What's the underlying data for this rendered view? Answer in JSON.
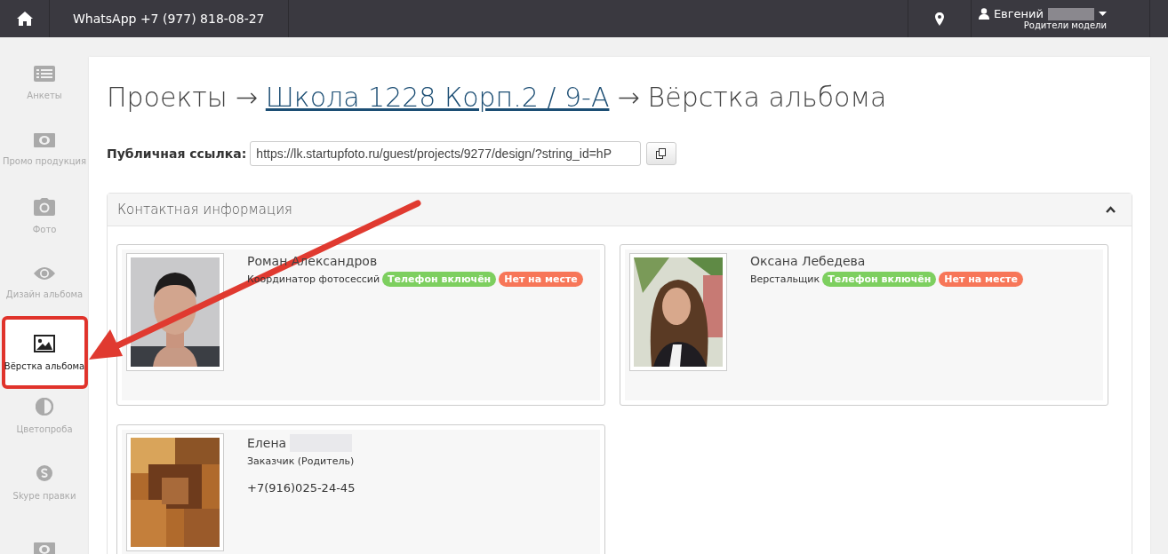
{
  "topbar": {
    "whatsapp": "WhatsApp +7 (977) 818-08-27",
    "user": {
      "name": "Евгений",
      "redacted": true,
      "role": "Родители модели"
    }
  },
  "sidebar": {
    "items": [
      {
        "label": "Анкеты",
        "selected": false
      },
      {
        "label": "Промо продукция",
        "selected": false
      },
      {
        "label": "Фото",
        "selected": false
      },
      {
        "label": "Дизайн альбома",
        "selected": false
      },
      {
        "label": "Вёрстка альбома",
        "selected": true
      },
      {
        "label": "Цветопроба",
        "selected": false
      },
      {
        "label": "Skype правки",
        "selected": false
      },
      {
        "selected": false
      }
    ]
  },
  "breadcrumb": {
    "root": "Проекты",
    "separator": "→",
    "link": "Школа 1228 Корп.2 / 9-А",
    "current": "Вёрстка альбома"
  },
  "public_link": {
    "label": "Публичная ссылка:",
    "value": "https://lk.startupfoto.ru/guest/projects/9277/design/?string_id=hP"
  },
  "contacts_panel": {
    "title": "Контактная информация",
    "expanded": true,
    "contacts": [
      {
        "name": "Роман Александров",
        "redacted": false,
        "role": "Координатор фотосессий",
        "badges": [
          {
            "label": "Телефон включён",
            "color": "#7dcf5f"
          },
          {
            "label": "Нет на месте",
            "color": "#f77658"
          }
        ]
      },
      {
        "name": "Оксана Лебедева",
        "redacted": false,
        "role": "Верстальщик",
        "badges": [
          {
            "label": "Телефон включён",
            "color": "#7dcf5f"
          },
          {
            "label": "Нет на месте",
            "color": "#f77658"
          }
        ]
      },
      {
        "name": "Елена",
        "redacted": true,
        "role": "Заказчик (Родитель)",
        "phone": "+7(916)025-24-45"
      }
    ]
  }
}
